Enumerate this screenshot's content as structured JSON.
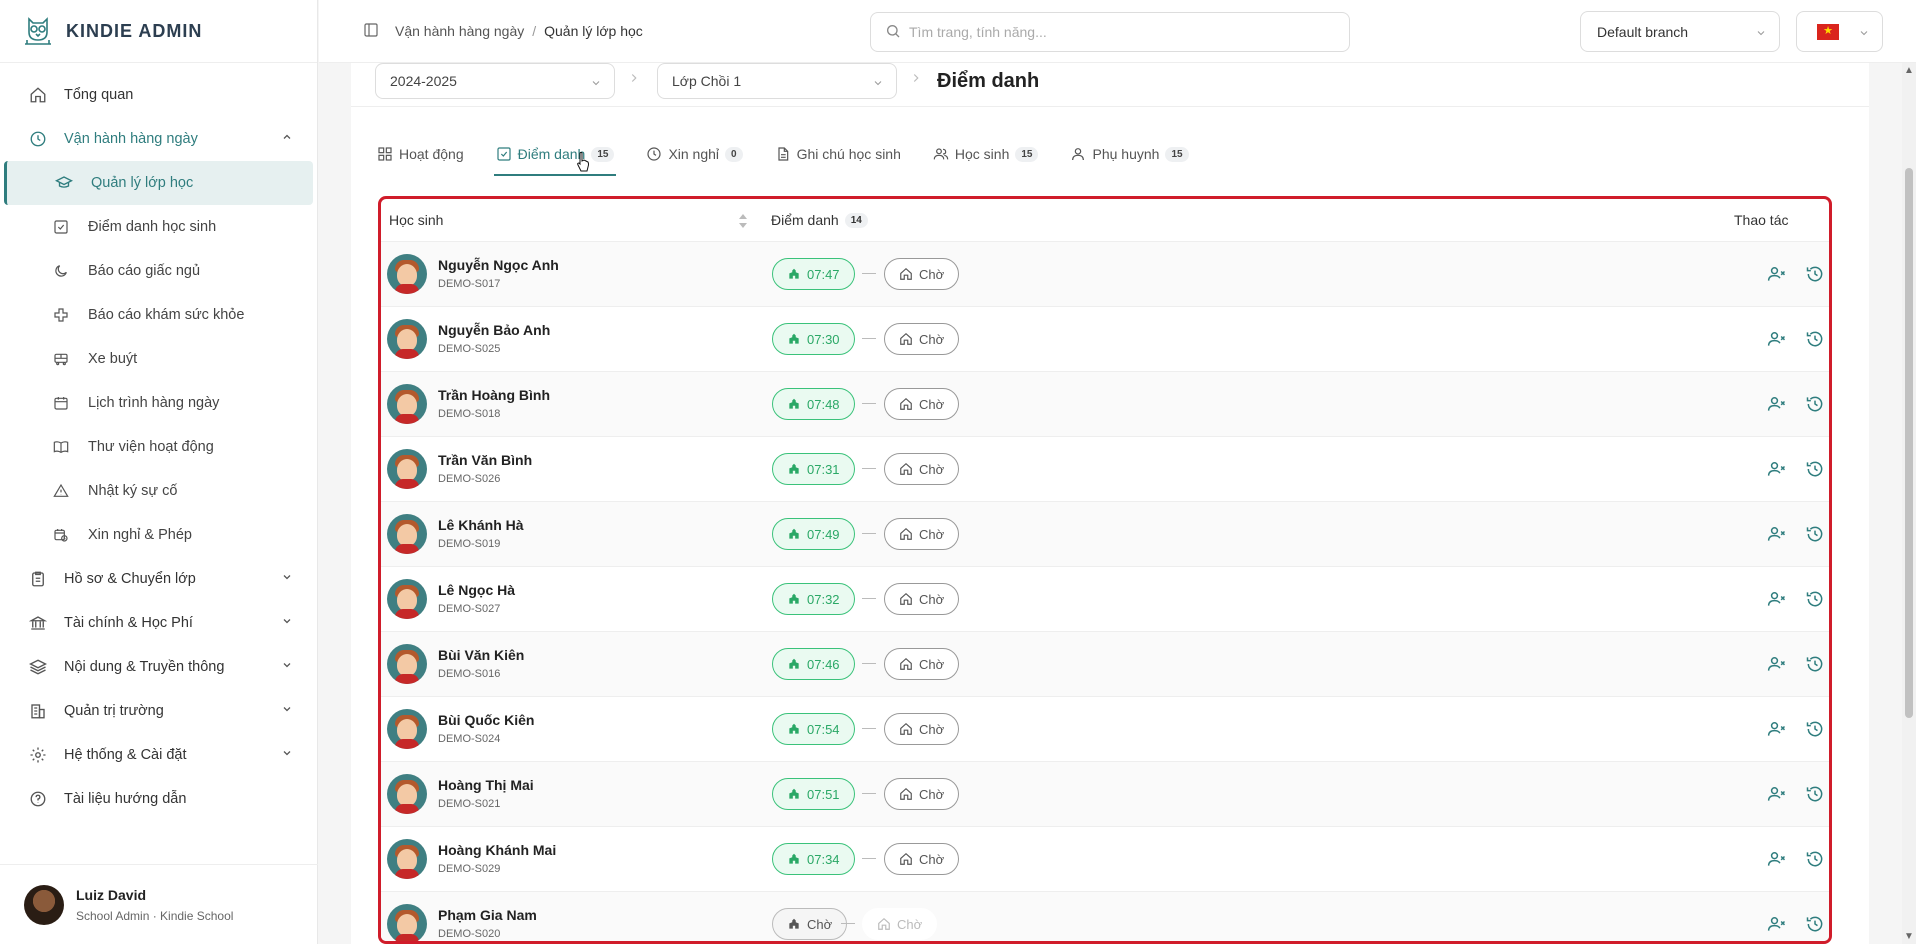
{
  "app": {
    "title": "KINDIE ADMIN"
  },
  "sidebar": {
    "items": [
      {
        "label": "Tổng quan",
        "icon": "home-icon"
      },
      {
        "label": "Vận hành hàng ngày",
        "icon": "clock-icon",
        "expanded": true,
        "children": [
          {
            "label": "Quản lý lớp học",
            "icon": "graduation-cap-icon",
            "active": true
          },
          {
            "label": "Điểm danh học sinh",
            "icon": "check-square-icon"
          },
          {
            "label": "Báo cáo giấc ngủ",
            "icon": "moon-icon"
          },
          {
            "label": "Báo cáo khám sức khỏe",
            "icon": "medical-cross-icon"
          },
          {
            "label": "Xe buýt",
            "icon": "bus-icon"
          },
          {
            "label": "Lịch trình hàng ngày",
            "icon": "calendar-icon"
          },
          {
            "label": "Thư viện hoạt động",
            "icon": "book-icon"
          },
          {
            "label": "Nhật ký sự cố",
            "icon": "warning-icon"
          },
          {
            "label": "Xin nghỉ & Phép",
            "icon": "calendar-clock-icon"
          }
        ]
      },
      {
        "label": "Hồ sơ & Chuyển lớp",
        "icon": "clipboard-icon"
      },
      {
        "label": "Tài chính & Học Phí",
        "icon": "bank-icon"
      },
      {
        "label": "Nội dung & Truyền thông",
        "icon": "layers-icon"
      },
      {
        "label": "Quản trị trường",
        "icon": "building-icon"
      },
      {
        "label": "Hệ thống & Cài đặt",
        "icon": "gear-icon"
      },
      {
        "label": "Tài liệu hướng dẫn",
        "icon": "help-icon"
      }
    ],
    "user": {
      "name": "Luiz David",
      "role": "School Admin · Kindie School"
    }
  },
  "header": {
    "breadcrumb": [
      "Vận hành hàng ngày",
      "Quản lý lớp học"
    ],
    "search_placeholder": "Tìm trang, tính năng...",
    "branch": "Default branch"
  },
  "filters": {
    "year": "2024-2025",
    "class": "Lớp Chồi 1",
    "page_title": "Điểm danh"
  },
  "tabs": [
    {
      "label": "Hoạt động",
      "icon": "grid-icon",
      "badge": null
    },
    {
      "label": "Điểm danh",
      "icon": "check-square-icon",
      "badge": "15",
      "active": true
    },
    {
      "label": "Xin nghỉ",
      "icon": "clock-icon",
      "badge": "0"
    },
    {
      "label": "Ghi chú học sinh",
      "icon": "document-icon",
      "badge": null
    },
    {
      "label": "Học sinh",
      "icon": "users-icon",
      "badge": "15"
    },
    {
      "label": "Phụ huynh",
      "icon": "user-icon",
      "badge": "15"
    }
  ],
  "table": {
    "col_student": "Học sinh",
    "col_attendance": "Điểm danh",
    "col_attendance_badge": "14",
    "col_actions": "Thao tác",
    "rows": [
      {
        "name": "Nguyễn Ngọc Anh",
        "code": "DEMO-S017",
        "checkin": "07:47",
        "checkout": "Chờ"
      },
      {
        "name": "Nguyễn Bảo Anh",
        "code": "DEMO-S025",
        "checkin": "07:30",
        "checkout": "Chờ"
      },
      {
        "name": "Trần Hoàng Bình",
        "code": "DEMO-S018",
        "checkin": "07:48",
        "checkout": "Chờ"
      },
      {
        "name": "Trần Văn Bình",
        "code": "DEMO-S026",
        "checkin": "07:31",
        "checkout": "Chờ"
      },
      {
        "name": "Lê Khánh Hà",
        "code": "DEMO-S019",
        "checkin": "07:49",
        "checkout": "Chờ"
      },
      {
        "name": "Lê Ngọc Hà",
        "code": "DEMO-S027",
        "checkin": "07:32",
        "checkout": "Chờ"
      },
      {
        "name": "Bùi Văn Kiên",
        "code": "DEMO-S016",
        "checkin": "07:46",
        "checkout": "Chờ"
      },
      {
        "name": "Bùi Quốc Kiên",
        "code": "DEMO-S024",
        "checkin": "07:54",
        "checkout": "Chờ"
      },
      {
        "name": "Hoàng Thị Mai",
        "code": "DEMO-S021",
        "checkin": "07:51",
        "checkout": "Chờ"
      },
      {
        "name": "Hoàng Khánh Mai",
        "code": "DEMO-S029",
        "checkin": "07:34",
        "checkout": "Chờ"
      },
      {
        "name": "Phạm Gia Nam",
        "code": "DEMO-S020",
        "checkin": "Chờ",
        "checkout": "Chờ",
        "pending": true
      }
    ]
  },
  "colors": {
    "accent": "#2f7d7e",
    "checkin": "#3ac27a",
    "highlight": "#d01c2a"
  }
}
